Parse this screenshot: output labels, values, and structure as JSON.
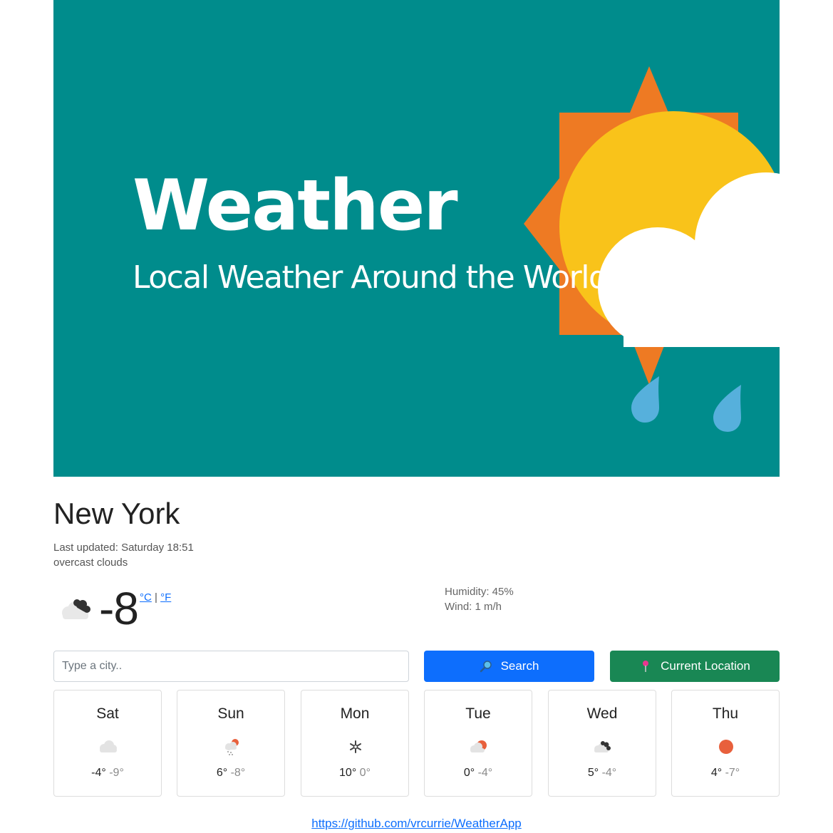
{
  "banner": {
    "title": "Weather",
    "subtitle": "Local Weather Around the World",
    "colors": {
      "background": "#008c8c",
      "sun_rays": "#ee7a23",
      "sun": "#f9c31a",
      "cloud": "#ffffff",
      "raindrop": "#56b0dc"
    }
  },
  "current": {
    "city": "New York",
    "last_updated": "Last updated: Saturday 18:51",
    "description": "overcast clouds",
    "temperature": "-8",
    "icon": "overcast-clouds-icon",
    "unit_celsius": "°C",
    "unit_separator": "|",
    "unit_fahrenheit": "°F",
    "humidity": "Humidity: 45%",
    "wind": "Wind: 1 m/h"
  },
  "search": {
    "placeholder": "Type a city..",
    "value": "",
    "search_label": "Search",
    "search_icon": "magnifying-glass-icon",
    "location_label": "Current Location",
    "location_icon": "pushpin-icon",
    "colors": {
      "search": "#0d6efd",
      "location": "#198754"
    }
  },
  "forecast": [
    {
      "day": "Sat",
      "max": "-4°",
      "min": "-9°",
      "icon": "cloud-icon"
    },
    {
      "day": "Sun",
      "max": "6°",
      "min": "-8°",
      "icon": "snow-sun-cloud-icon"
    },
    {
      "day": "Mon",
      "max": "10°",
      "min": "0°",
      "icon": "snowflake-icon"
    },
    {
      "day": "Tue",
      "max": "0°",
      "min": "-4°",
      "icon": "sun-behind-cloud-icon"
    },
    {
      "day": "Wed",
      "max": "5°",
      "min": "-4°",
      "icon": "overcast-clouds-icon"
    },
    {
      "day": "Thu",
      "max": "4°",
      "min": "-7°",
      "icon": "sun-icon"
    }
  ],
  "footer": {
    "link": "https://github.com/vrcurrie/WeatherApp"
  }
}
